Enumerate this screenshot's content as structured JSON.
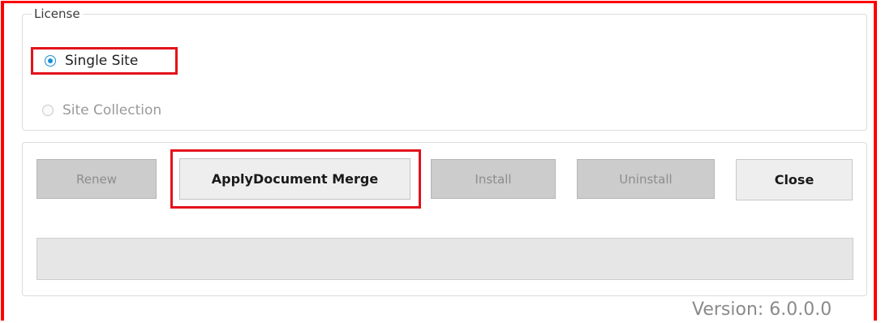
{
  "license": {
    "legend": "License",
    "options": [
      {
        "label": "Single Site",
        "selected": true,
        "enabled": true
      },
      {
        "label": "Site Collection",
        "selected": false,
        "enabled": false
      }
    ]
  },
  "buttons": {
    "renew": "Renew",
    "apply": "ApplyDocument Merge",
    "install": "Install",
    "uninstall": "Uninstall",
    "close": "Close"
  },
  "version": "Version: 6.0.0.0",
  "colors": {
    "highlight": "#e4121c",
    "radio_accent": "#1a8ed6",
    "disabled_button": "#cccccc"
  }
}
